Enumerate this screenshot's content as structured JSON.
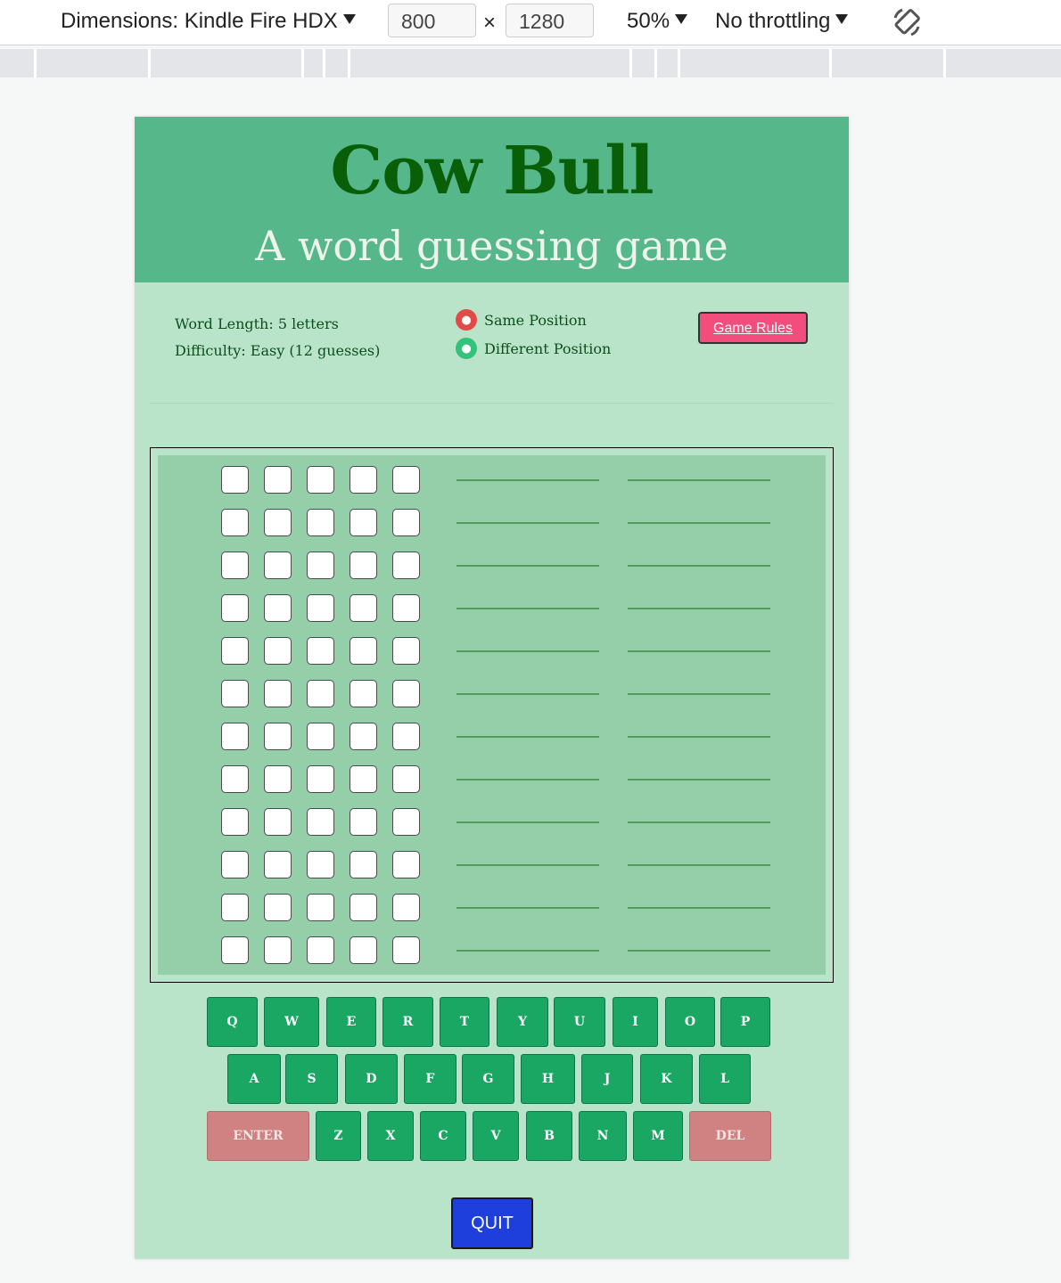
{
  "devtools": {
    "dimensions_label": "Dimensions: Kindle Fire HDX",
    "width": "800",
    "times": "×",
    "height": "1280",
    "zoom": "50%",
    "throttling": "No throttling",
    "rotate_icon": "rotate-icon"
  },
  "game": {
    "title": "Cow Bull",
    "subtitle": "A word guessing game",
    "word_length": "Word Length: 5 letters",
    "difficulty": "Difficulty: Easy (12 guesses)",
    "legend": [
      {
        "icon": "bull-icon",
        "label": "Same Position"
      },
      {
        "icon": "cow-icon",
        "label": "Different Position"
      }
    ],
    "rules_button": "Game Rules",
    "quit_button": "QUIT"
  },
  "keyboard": {
    "row1": [
      "Q",
      "W",
      "E",
      "R",
      "T",
      "Y",
      "U",
      "I",
      "O",
      "P"
    ],
    "row2": [
      "A",
      "S",
      "D",
      "F",
      "G",
      "H",
      "J",
      "K",
      "L"
    ],
    "row3": [
      "ENTER",
      "Z",
      "X",
      "C",
      "V",
      "B",
      "N",
      "M",
      "DEL"
    ]
  },
  "colors": {
    "header": "#56b78a",
    "title": "#085f08",
    "key": "#1aa763",
    "action_key": "#d08181",
    "quit": "#1f3fdc",
    "rules": "#f24d7d"
  }
}
